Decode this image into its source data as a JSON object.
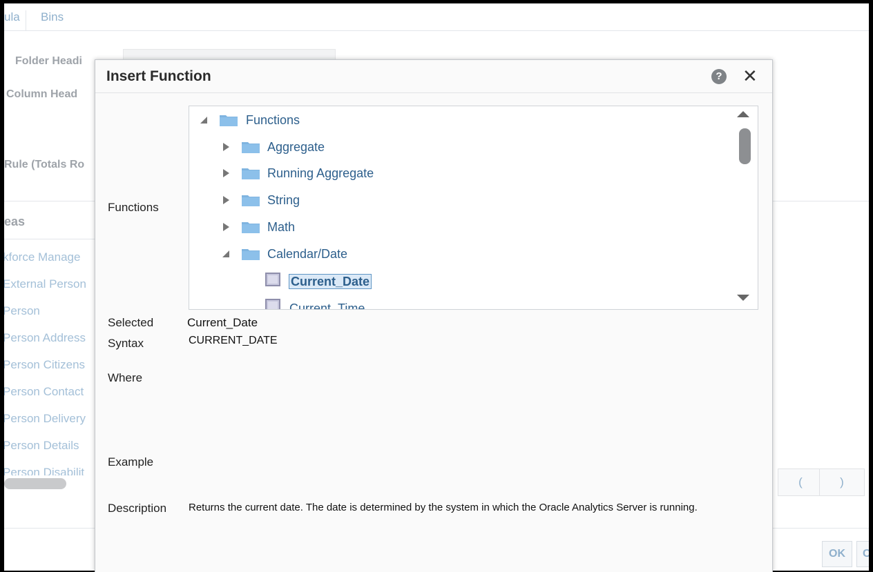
{
  "background": {
    "tabs": [
      {
        "label": "ula"
      },
      {
        "label": "Bins"
      }
    ],
    "labels": {
      "folder_heading": "Folder Headi",
      "column_heading": "Column Head",
      "rule": "Rule (Totals Ro"
    },
    "areas_heading": "eas",
    "areas": [
      "kforce Manage",
      "External Person",
      "Person",
      "Person Address",
      "Person Citizens",
      "Person Contact",
      "Person Delivery",
      "Person Details",
      "Person Disabilit"
    ],
    "operators": [
      "(",
      ")"
    ],
    "ok_button": "OK",
    "cancel_button_partial": "C"
  },
  "dialog": {
    "title": "Insert Function",
    "help_icon": "help-icon",
    "close_icon": "close-icon",
    "functions_label": "Functions",
    "tree": {
      "root": "Functions",
      "folders": [
        "Aggregate",
        "Running Aggregate",
        "String",
        "Math"
      ],
      "expanded_folder": "Calendar/Date",
      "children": [
        "Current_Date",
        "Current_Time"
      ],
      "selected": "Current_Date"
    },
    "selected_label": "Selected",
    "selected_value": "Current_Date",
    "syntax_label": "Syntax",
    "syntax_value": "CURRENT_DATE",
    "where_label": "Where",
    "example_label": "Example",
    "description_label": "Description",
    "description_value": "Returns the current date. The date is determined by the system in which the Oracle Analytics Server is running."
  },
  "colors": {
    "link_blue": "#2d5f8c",
    "folder_blue": "#7fb4e0",
    "selection_bg": "#dbe9f7"
  }
}
